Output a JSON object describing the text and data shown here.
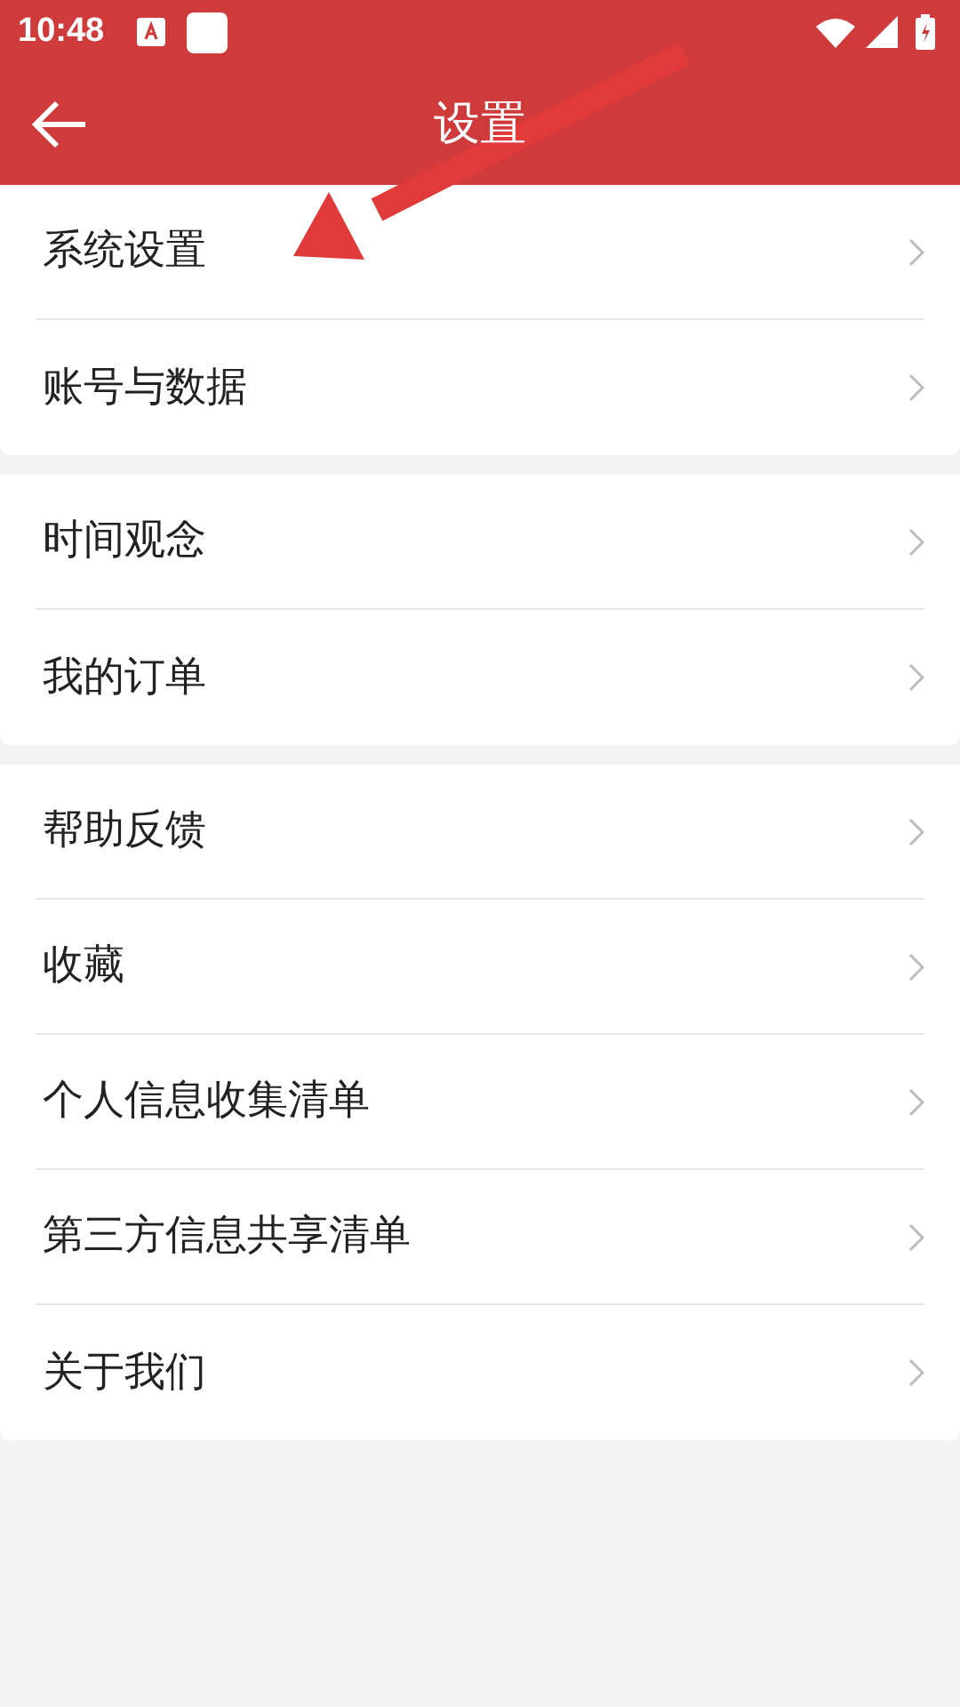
{
  "status_bar": {
    "time": "10:48"
  },
  "header": {
    "title": "设置"
  },
  "groups": [
    {
      "items": [
        {
          "label": "系统设置"
        },
        {
          "label": "账号与数据"
        }
      ]
    },
    {
      "items": [
        {
          "label": "时间观念"
        },
        {
          "label": "我的订单"
        }
      ]
    },
    {
      "items": [
        {
          "label": "帮助反馈"
        },
        {
          "label": "收藏"
        },
        {
          "label": "个人信息收集清单"
        },
        {
          "label": "第三方信息共享清单"
        },
        {
          "label": "关于我们"
        }
      ]
    }
  ]
}
